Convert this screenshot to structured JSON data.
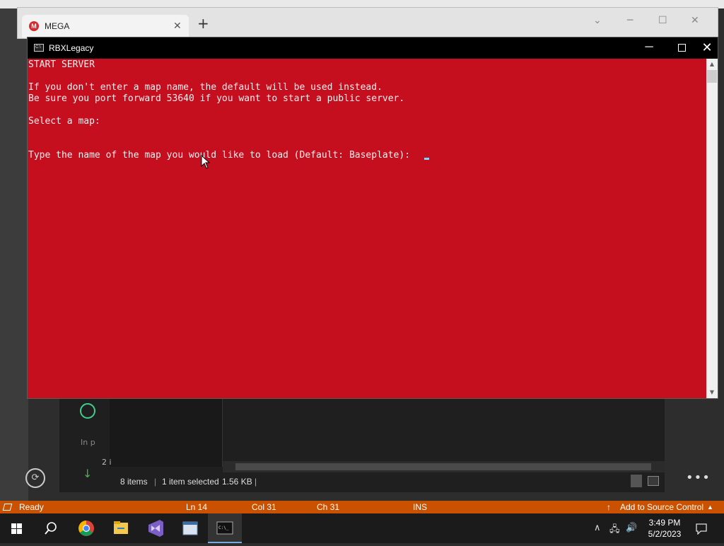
{
  "browser": {
    "tab_title": "MEGA",
    "logo_letter": "M",
    "tab_close": "✕",
    "new_tab": "+"
  },
  "console": {
    "title": "RBXLegacy",
    "lines": [
      "START SERVER",
      "",
      "If you don't enter a map name, the default will be used instead.",
      "Be sure you port forward 53640 if you want to start a public server.",
      "",
      "Select a map:",
      "",
      "",
      "Type the name of the map you would like to load (Default: Baseplate): "
    ],
    "minimize": "─",
    "close": "✕"
  },
  "explorer": {
    "item_count": "8 items",
    "selection": "1 item selected",
    "size": "1.56 KB",
    "left_label_in": "In p",
    "left_label_2": "2 i"
  },
  "vs_status": {
    "ready": "Ready",
    "ln": "Ln 14",
    "col": "Col 31",
    "ch": "Ch 31",
    "mode": "INS",
    "source_control": "Add to Source Control"
  },
  "taskbar": {
    "time": "3:49 PM",
    "date": "5/2/2023"
  }
}
